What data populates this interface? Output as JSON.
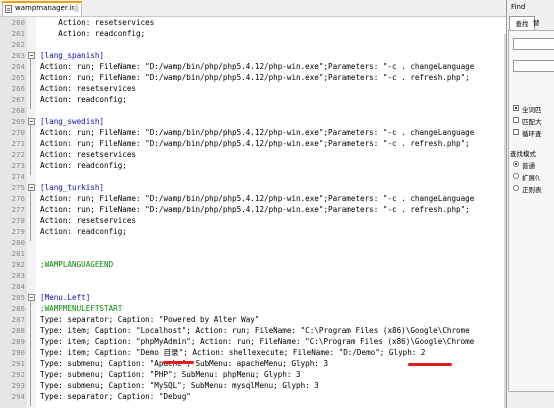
{
  "tab": {
    "filename": "wampmanager.ini"
  },
  "editor": {
    "lines": [
      {
        "n": "260",
        "t": "    Action: resetservices",
        "c": "kw"
      },
      {
        "n": "261",
        "t": "    Action: readconfig;",
        "c": "kw"
      },
      {
        "n": "262",
        "t": "",
        "c": "kw"
      },
      {
        "n": "263",
        "t": "[lang_spanish]",
        "c": "sec",
        "fold": true
      },
      {
        "n": "264",
        "t": "Action: run; FileName: \"D:/wamp/bin/php/php5.4.12/php-win.exe\";Parameters: \"-c . changeLanguage",
        "c": "kw"
      },
      {
        "n": "265",
        "t": "Action: run; FileName: \"D:/wamp/bin/php/php5.4.12/php-win.exe\";Parameters: \"-c . refresh.php\";",
        "c": "kw"
      },
      {
        "n": "266",
        "t": "Action: resetservices",
        "c": "kw"
      },
      {
        "n": "267",
        "t": "Action: readconfig;",
        "c": "kw"
      },
      {
        "n": "268",
        "t": "",
        "c": "kw"
      },
      {
        "n": "269",
        "t": "[lang_swedish]",
        "c": "sec",
        "fold": true
      },
      {
        "n": "270",
        "t": "Action: run; FileName: \"D:/wamp/bin/php/php5.4.12/php-win.exe\";Parameters: \"-c . changeLanguage",
        "c": "kw"
      },
      {
        "n": "271",
        "t": "Action: run; FileName: \"D:/wamp/bin/php/php5.4.12/php-win.exe\";Parameters: \"-c . refresh.php\";",
        "c": "kw"
      },
      {
        "n": "272",
        "t": "Action: resetservices",
        "c": "kw"
      },
      {
        "n": "273",
        "t": "Action: readconfig;",
        "c": "kw"
      },
      {
        "n": "274",
        "t": "",
        "c": "kw"
      },
      {
        "n": "275",
        "t": "[lang_turkish]",
        "c": "sec",
        "fold": true
      },
      {
        "n": "276",
        "t": "Action: run; FileName: \"D:/wamp/bin/php/php5.4.12/php-win.exe\";Parameters: \"-c . changeLanguage",
        "c": "kw"
      },
      {
        "n": "277",
        "t": "Action: run; FileName: \"D:/wamp/bin/php/php5.4.12/php-win.exe\";Parameters: \"-c . refresh.php\";",
        "c": "kw"
      },
      {
        "n": "278",
        "t": "Action: resetservices",
        "c": "kw"
      },
      {
        "n": "279",
        "t": "Action: readconfig;",
        "c": "kw"
      },
      {
        "n": "280",
        "t": "",
        "c": "kw"
      },
      {
        "n": "281",
        "t": "",
        "c": "kw"
      },
      {
        "n": "282",
        "t": ";WAMPLANGUAGEEND",
        "c": "cmt"
      },
      {
        "n": "283",
        "t": "",
        "c": "kw"
      },
      {
        "n": "284",
        "t": "",
        "c": "kw"
      },
      {
        "n": "285",
        "t": "[Menu.Left]",
        "c": "sec",
        "fold": true
      },
      {
        "n": "286",
        "t": ";WAMPMENULEFTSTART",
        "c": "cmt"
      },
      {
        "n": "287",
        "t": "Type: separator; Caption: \"Powered by Alter Way\"",
        "c": "kw"
      },
      {
        "n": "288",
        "t": "Type: item; Caption: \"Localhost\"; Action: run; FileName: \"C:\\Program Files (x86)\\Google\\Chrome",
        "c": "kw"
      },
      {
        "n": "289",
        "t": "Type: item; Caption: \"phpMyAdmin\"; Action: run; FileName: \"C:\\Program Files (x86)\\Google\\Chrome",
        "c": "kw"
      },
      {
        "n": "290",
        "t": "Type: item; Caption: \"Demo 目录\"; Action: shellexecute; FileName: \"D:/Demo\"; Glyph: 2",
        "c": "kw"
      },
      {
        "n": "291",
        "t": "Type: submenu; Caption: \"Apache\"; SubMenu: apacheMenu; Glyph: 3",
        "c": "kw"
      },
      {
        "n": "292",
        "t": "Type: submenu; Caption: \"PHP\"; SubMenu: phpMenu; Glyph: 3",
        "c": "kw"
      },
      {
        "n": "293",
        "t": "Type: submenu; Caption: \"MySQL\"; SubMenu: mysqlMenu; Glyph: 3",
        "c": "kw"
      },
      {
        "n": "294",
        "t": "Type: separator; Caption: \"Debug\"",
        "c": "kw"
      }
    ]
  },
  "find_panel": {
    "title": "Find",
    "tab1": "查找",
    "tab2": "替",
    "options": [
      {
        "label": "全词匹",
        "checked": true
      },
      {
        "label": "匹配大",
        "checked": false
      },
      {
        "label": "循环查",
        "checked": false
      }
    ],
    "mode_label": "查找模式",
    "modes": [
      {
        "label": "普通",
        "selected": true
      },
      {
        "label": "扩展(\\",
        "selected": false
      },
      {
        "label": "正则表",
        "selected": false
      }
    ]
  },
  "colors": {
    "section": "#0f0fb0",
    "comment": "#0a8a0a",
    "annotation": "#e02020",
    "tab_accent": "#f7a000"
  }
}
